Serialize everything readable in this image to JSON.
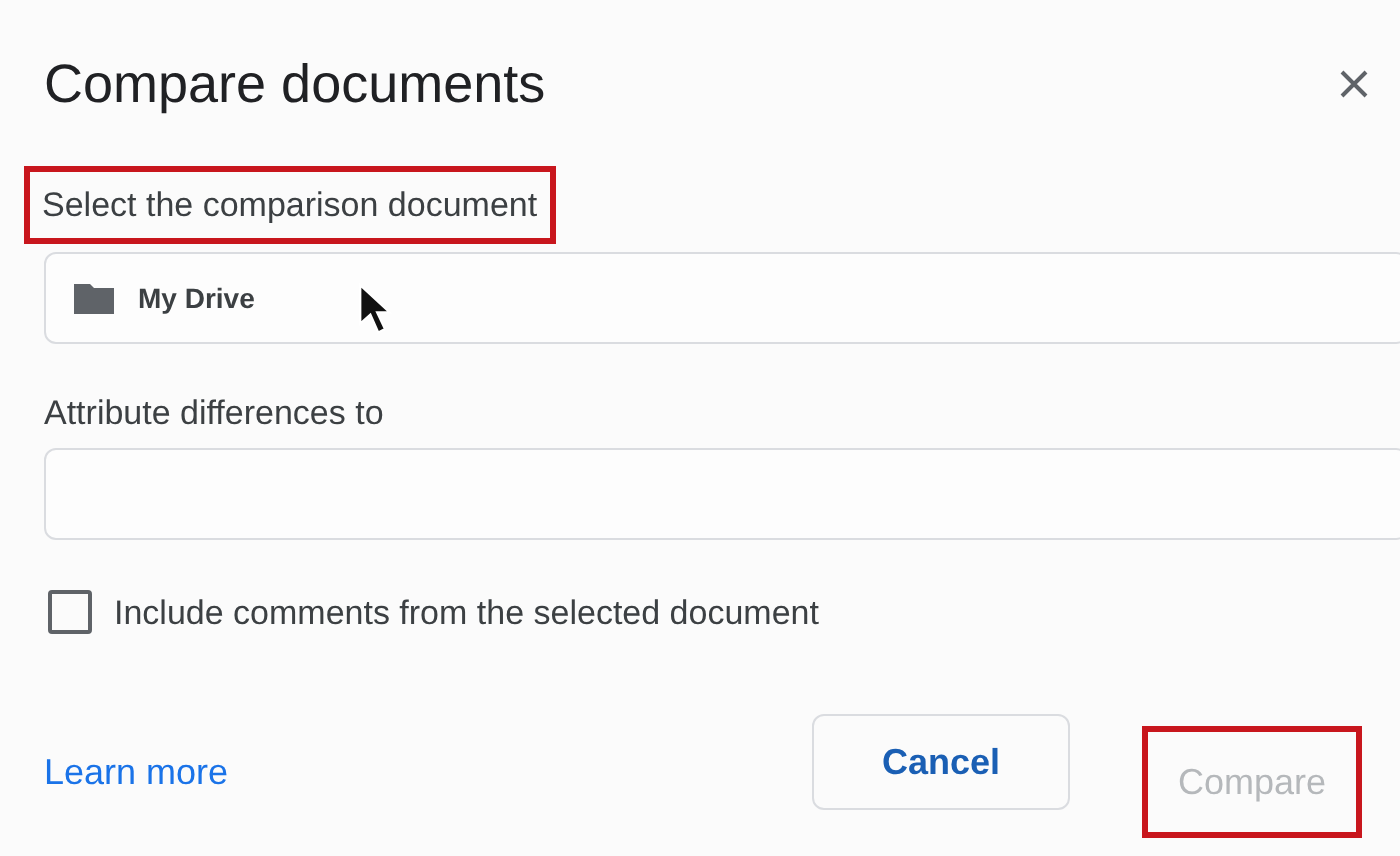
{
  "dialog": {
    "title": "Compare documents"
  },
  "fields": [
    {
      "label": "Select the comparison document",
      "highlighted": true,
      "value": "My Drive",
      "folder_icon": true,
      "cursor": true
    },
    {
      "label": "Attribute differences to",
      "highlighted": false
    }
  ],
  "checkbox": {
    "label": "Include comments from the selected document",
    "checked": false
  },
  "link": "Learn more",
  "buttons": [
    {
      "label": "Cancel",
      "disabled": false,
      "highlighted": false
    },
    {
      "label": "Compare",
      "disabled": true,
      "highlighted": true
    }
  ]
}
